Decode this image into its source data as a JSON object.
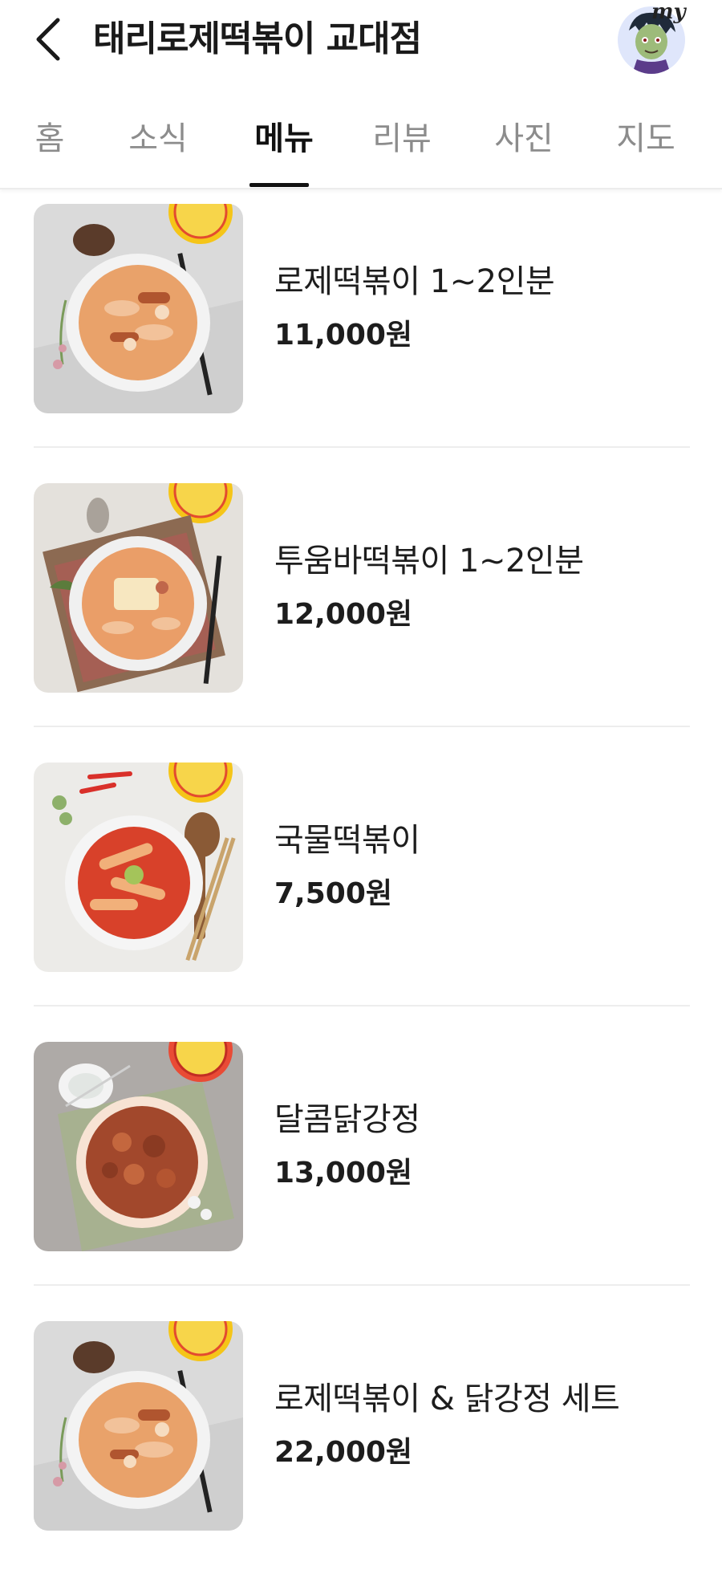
{
  "header": {
    "title": "태리로제떡볶이 교대점",
    "back_icon": "chevron-left-icon",
    "avatar_badge": "my"
  },
  "tabs": [
    {
      "label": "홈",
      "active": false
    },
    {
      "label": "소식",
      "active": false
    },
    {
      "label": "메뉴",
      "active": true
    },
    {
      "label": "리뷰",
      "active": false
    },
    {
      "label": "사진",
      "active": false
    },
    {
      "label": "지도",
      "active": false
    }
  ],
  "menu": [
    {
      "name": "로제떡볶이 1~2인분",
      "price": "11,000원",
      "photo": "rose-tteokbokki"
    },
    {
      "name": "투움바떡볶이 1~2인분",
      "price": "12,000원",
      "photo": "toowoomba-tteokbokki"
    },
    {
      "name": "국물떡볶이",
      "price": "7,500원",
      "photo": "soup-tteokbokki"
    },
    {
      "name": "달콤닭강정",
      "price": "13,000원",
      "photo": "sweet-chicken"
    },
    {
      "name": "로제떡볶이 & 닭강정 세트",
      "price": "22,000원",
      "photo": "rose-set"
    }
  ],
  "colors": {
    "active_tab": "#111111",
    "inactive_tab": "#8c8c8c",
    "divider": "#ededed"
  }
}
